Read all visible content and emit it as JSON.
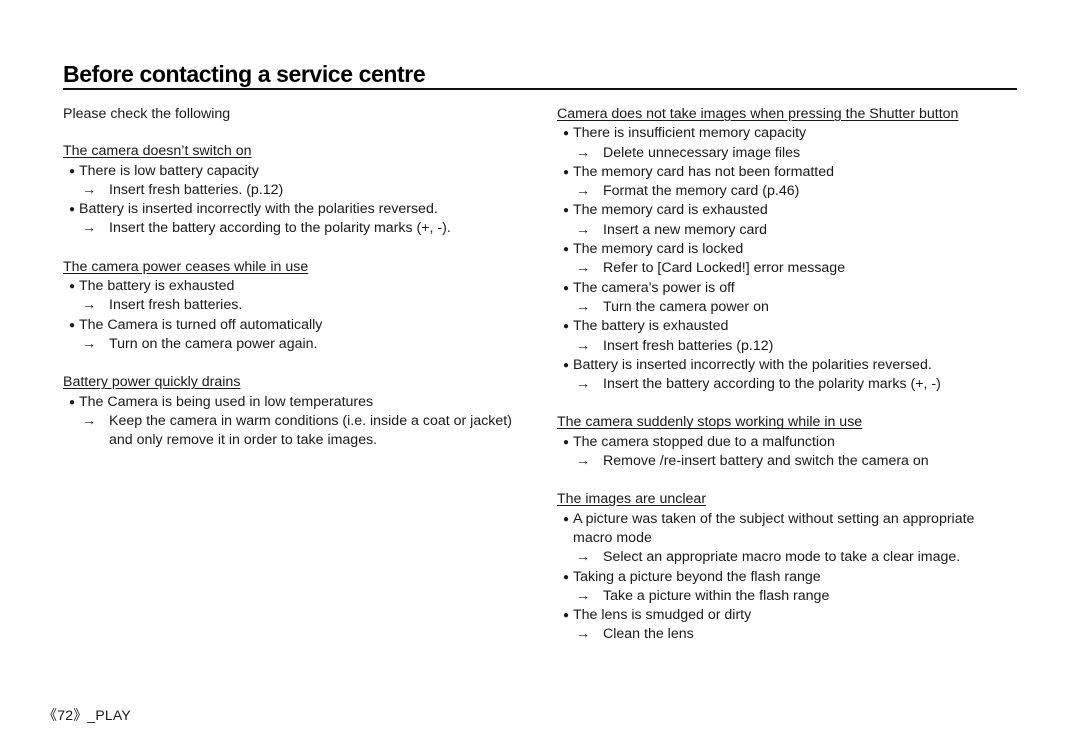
{
  "title": "Before contacting a service centre",
  "intro": "Please check the following",
  "left_sections": [
    {
      "heading": "The camera doesn’t switch on",
      "items": [
        {
          "cause": "There is low battery capacity",
          "fix": "Insert fresh batteries. (p.12)"
        },
        {
          "cause": "Battery is inserted incorrectly with the polarities reversed.",
          "fix": "Insert the battery according to the polarity marks (+, -)."
        }
      ]
    },
    {
      "heading": "The camera power ceases while in use",
      "items": [
        {
          "cause": "The battery is exhausted",
          "fix": "Insert fresh batteries."
        },
        {
          "cause": "The Camera is turned off automatically",
          "fix": "Turn on the camera power again."
        }
      ]
    },
    {
      "heading": "Battery power quickly drains",
      "items": [
        {
          "cause": "The Camera is being used in low temperatures",
          "fix": "Keep the camera in warm conditions (i.e. inside a coat or jacket) and only remove it in order to take images."
        }
      ]
    }
  ],
  "right_sections": [
    {
      "heading": "Camera does not take images when pressing the Shutter button",
      "items": [
        {
          "cause": "There is insufficient memory capacity",
          "fix": "Delete unnecessary image files"
        },
        {
          "cause": "The memory card has not been formatted",
          "fix": "Format the memory card (p.46)"
        },
        {
          "cause": "The memory card is exhausted",
          "fix": "Insert a new memory card"
        },
        {
          "cause": "The memory card is locked",
          "fix": "Refer to [Card Locked!] error message"
        },
        {
          "cause": "The camera's power is off",
          "fix": "Turn the camera power on"
        },
        {
          "cause": "The battery is exhausted",
          "fix": "Insert fresh batteries (p.12)"
        },
        {
          "cause": "Battery is inserted incorrectly with the polarities reversed.",
          "fix": "Insert the battery according to the polarity marks (+, -)"
        }
      ]
    },
    {
      "heading": "The camera suddenly stops working while in use",
      "items": [
        {
          "cause": "The camera stopped due to a malfunction",
          "fix": "Remove /re-insert battery and switch the camera on"
        }
      ]
    },
    {
      "heading": "The images are unclear",
      "items": [
        {
          "cause": "A picture was taken of the subject without setting an appropriate macro mode",
          "fix": "Select an appropriate macro mode to take a clear image."
        },
        {
          "cause": "Taking a picture beyond the flash range",
          "fix": "Take a picture within the flash range"
        },
        {
          "cause": "The lens is smudged or dirty",
          "fix": "Clean the lens"
        }
      ]
    }
  ],
  "symbols": {
    "bullet": "●",
    "arrow": "→"
  },
  "footer": {
    "page_number": "72",
    "section": "_PLAY",
    "open_bracket": "《",
    "close_bracket": "》"
  }
}
